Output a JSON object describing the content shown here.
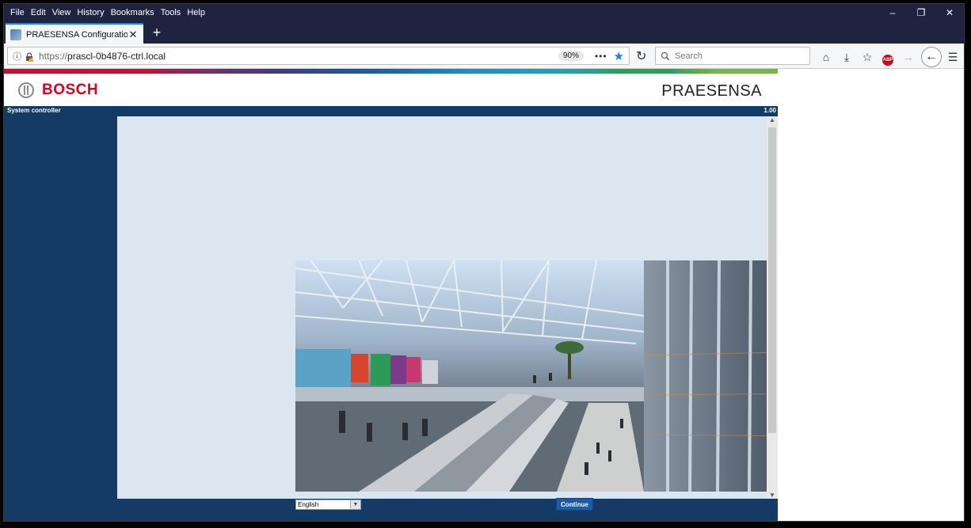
{
  "browser": {
    "menu": [
      "File",
      "Edit",
      "View",
      "History",
      "Bookmarks",
      "Tools",
      "Help"
    ],
    "tab_title": "PRAESENSA Configuration",
    "url_scheme": "https://",
    "url_host": "prascl-0b4876-ctrl.local",
    "zoom": "90%",
    "search_placeholder": "Search"
  },
  "page": {
    "brand": "BOSCH",
    "product": "PRAESENSA",
    "status_left": "System controller",
    "version": "1.00",
    "language_selected": "English",
    "continue_label": "Continue"
  }
}
